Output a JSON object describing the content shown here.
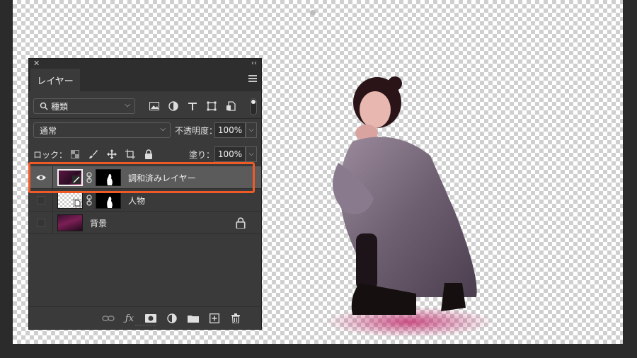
{
  "panel": {
    "tab_label": "レイヤー",
    "filter": {
      "kind_label": "種類"
    },
    "blend": {
      "mode": "通常",
      "opacity_label": "不透明度：",
      "opacity_value": "100%"
    },
    "lock": {
      "label": "ロック：",
      "fill_label": "塗り：",
      "fill_value": "100%"
    },
    "layers": [
      {
        "name": "調和済みレイヤー",
        "visible": true,
        "selected": true
      },
      {
        "name": "人物",
        "visible": false,
        "selected": false
      },
      {
        "name": "背景",
        "visible": false,
        "selected": false,
        "locked": true
      }
    ]
  },
  "colors": {
    "highlight": "#f05a24",
    "panel_bg": "#3a3a3a",
    "selected_row": "#5b5b5b"
  }
}
